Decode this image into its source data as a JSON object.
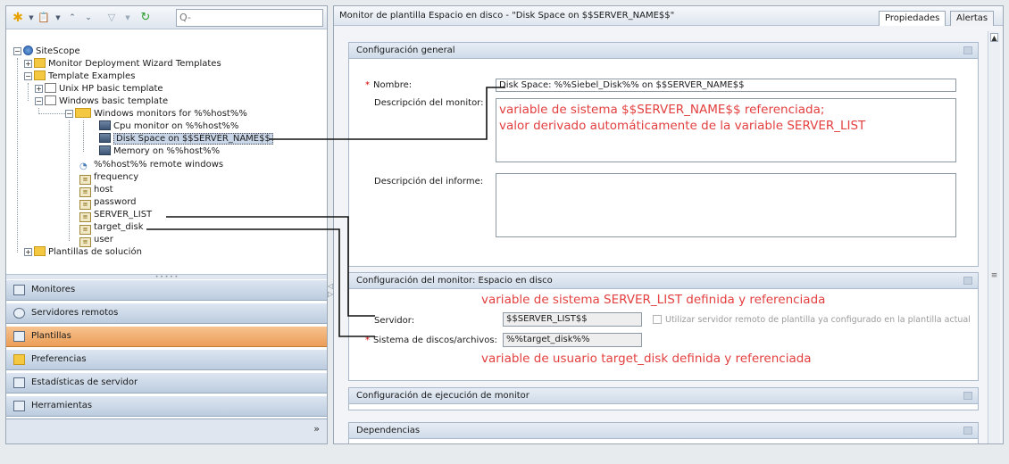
{
  "toolbar": {
    "search_placeholder": "Q-"
  },
  "tree": {
    "root": "SiteScope",
    "monitor_deployment": "Monitor Deployment Wizard Templates",
    "template_examples": "Template Examples",
    "unix_template": "Unix HP basic template",
    "windows_template": "Windows basic template",
    "windows_monitors": "Windows monitors for %%host%%",
    "cpu_monitor": "Cpu monitor on %%host%%",
    "disk_space": "Disk Space on $$SERVER_NAME$$",
    "memory": "Memory on %%host%%",
    "remote_windows": "%%host%% remote windows",
    "var_frequency": "frequency",
    "var_host": "host",
    "var_password": "password",
    "var_server_list": "SERVER_LIST",
    "var_target_disk": "target_disk",
    "var_user": "user",
    "solution_templates": "Plantillas de solución"
  },
  "nav": {
    "monitores": "Monitores",
    "servidores": "Servidores remotos",
    "plantillas": "Plantillas",
    "preferencias": "Preferencias",
    "estadisticas": "Estadísticas de servidor",
    "herramientas": "Herramientas"
  },
  "right": {
    "title": "Monitor de plantilla Espacio en disco - \"Disk Space on $$SERVER_NAME$$\"",
    "tab_properties": "Propiedades",
    "tab_alerts": "Alertas"
  },
  "general": {
    "header": "Configuración general",
    "name_label": "Nombre:",
    "name_value": "Disk Space: %%Siebel_Disk%%  on $$SERVER_NAME$$",
    "desc_label": "Descripción del monitor:",
    "report_label": "Descripción del informe:"
  },
  "monitor_settings": {
    "header": "Configuración del monitor: Espacio en disco",
    "server_label": "Servidor:",
    "server_value": "$$SERVER_LIST$$",
    "checkbox_label": "Utilizar servidor remoto de plantilla ya configurado en la plantilla actual",
    "disk_label": "Sistema de discos/archivos:",
    "disk_value": "%%target_disk%%"
  },
  "run_settings": {
    "header": "Configuración de ejecución de monitor"
  },
  "dependencies": {
    "header": "Dependencias"
  },
  "annotations": {
    "desc_line1": "variable de sistema $$SERVER_NAME$$ referenciada;",
    "desc_line2": "valor derivado automáticamente de la variable SERVER_LIST",
    "server_list": "variable de sistema SERVER_LIST definida y referenciada",
    "target_disk": "variable de usuario target_disk definida y referenciada"
  },
  "colors": {
    "annotation": "#e33f3f",
    "active_nav": "#eb9d57",
    "required": "#d00000"
  }
}
